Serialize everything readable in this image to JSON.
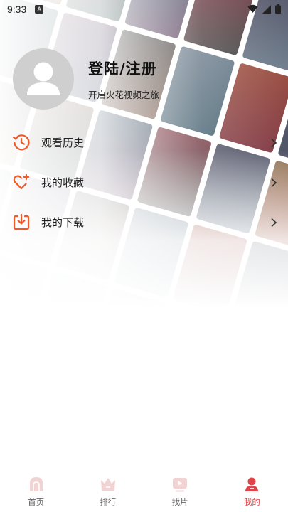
{
  "status_bar": {
    "time": "9:33",
    "notification_badge": "A"
  },
  "profile": {
    "title": "登陆/注册",
    "subtitle": "开启火花视频之旅"
  },
  "menu": {
    "items": [
      {
        "label": "观看历史",
        "icon": "history-icon"
      },
      {
        "label": "我的收藏",
        "icon": "heart-plus-icon"
      },
      {
        "label": "我的下载",
        "icon": "download-icon"
      }
    ]
  },
  "bottom_nav": {
    "items": [
      {
        "label": "首页",
        "icon": "home-icon",
        "active": false
      },
      {
        "label": "排行",
        "icon": "crown-icon",
        "active": false
      },
      {
        "label": "找片",
        "icon": "video-icon",
        "active": false
      },
      {
        "label": "我的",
        "icon": "person-icon",
        "active": true
      }
    ]
  },
  "colors": {
    "accent": "#f05a28",
    "nav_active": "#e0444a",
    "nav_inactive": "#c9c9c9",
    "avatar_bg": "#cfcfcf"
  }
}
